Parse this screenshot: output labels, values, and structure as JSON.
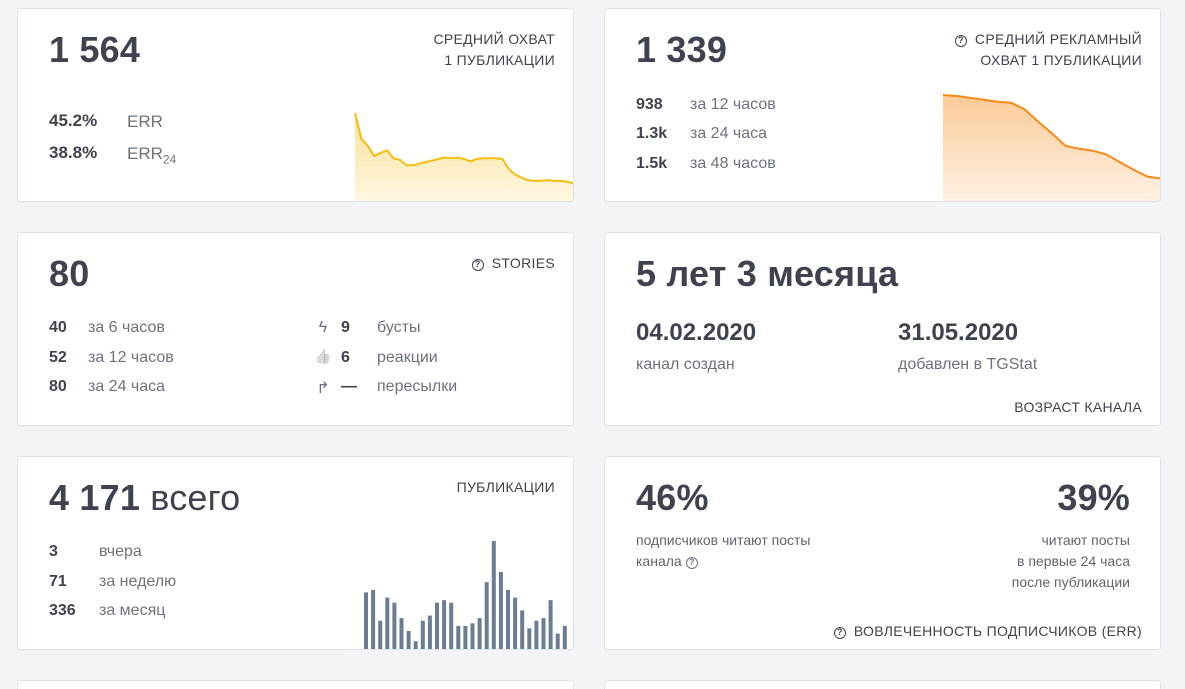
{
  "reach": {
    "value": "1 564",
    "caption_line1": "СРЕДНИЙ ОХВАТ",
    "caption_line2": "1 ПУБЛИКАЦИИ",
    "err_value": "45.2%",
    "err_label": "ERR",
    "err24_value": "38.8%",
    "err24_label": "ERR",
    "err24_sub": "24",
    "chart_color": "#f5bd0f"
  },
  "ad_reach": {
    "value": "1 339",
    "caption_line1": "СРЕДНИЙ РЕКЛАМНЫЙ",
    "caption_line2": "ОХВАТ 1 ПУБЛИКАЦИИ",
    "help_icon": "?",
    "rows": [
      {
        "value": "938",
        "label": "за 12 часов"
      },
      {
        "value": "1.3k",
        "label": "за 24 часа"
      },
      {
        "value": "1.5k",
        "label": "за 48 часов"
      }
    ],
    "chart_color": "#f78a16"
  },
  "stories": {
    "value": "80",
    "caption": "STORIES",
    "help_icon": "?",
    "rows": [
      {
        "value": "40",
        "label": "за 6 часов"
      },
      {
        "value": "52",
        "label": "за 12 часов"
      },
      {
        "value": "80",
        "label": "за 24 часа"
      }
    ],
    "stats": [
      {
        "icon": "lightning-icon",
        "glyph": "ϟ",
        "value": "9",
        "label": "бусты"
      },
      {
        "icon": "thumbs-up-icon",
        "glyph": "👍",
        "value": "6",
        "label": "реакции"
      },
      {
        "icon": "share-arrow-icon",
        "glyph": "↱",
        "value": "—",
        "label": "пересылки"
      }
    ]
  },
  "age": {
    "value": "5 лет 3 месяца",
    "created_date": "04.02.2020",
    "created_label": "канал создан",
    "added_date": "31.05.2020",
    "added_label": "добавлен в TGStat",
    "caption": "ВОЗРАСТ КАНАЛА"
  },
  "posts": {
    "value": "4 171",
    "suffix": "всего",
    "caption": "ПУБЛИКАЦИИ",
    "rows": [
      {
        "value": "3",
        "label": "вчера"
      },
      {
        "value": "71",
        "label": "за неделю"
      },
      {
        "value": "336",
        "label": "за месяц"
      }
    ],
    "bar_color": "#6a7d94"
  },
  "engagement": {
    "left_value": "46%",
    "left_text_line1": "подписчиков читают посты",
    "left_text_line2": "канала",
    "right_value": "39%",
    "right_text_line1": "читают посты",
    "right_text_line2": "в первые 24 часа",
    "right_text_line3": "после публикации",
    "caption": "ВОВЛЕЧЕННОСТЬ ПОДПИСЧИКОВ (ERR)",
    "help_icon": "?"
  },
  "chart_data": [
    {
      "type": "area",
      "series": [
        {
          "values": [
            100,
            67,
            58,
            45,
            49,
            52,
            42,
            40,
            33,
            33,
            35,
            37,
            39,
            41,
            43,
            42,
            43,
            41,
            38,
            41,
            42,
            42,
            42,
            41,
            28,
            21,
            17,
            14,
            13,
            13,
            14,
            13,
            13,
            12,
            10
          ]
        }
      ]
    },
    {
      "type": "area",
      "series": [
        {
          "values": [
            100,
            99,
            97,
            95,
            93,
            92,
            85,
            72,
            60,
            47,
            44,
            42,
            38,
            30,
            22,
            15,
            13
          ]
        }
      ]
    },
    {
      "type": "bar",
      "values": [
        22,
        23,
        11,
        20,
        18,
        12,
        7,
        3,
        11,
        13,
        18,
        19,
        18,
        9,
        9,
        10,
        12,
        26,
        42,
        30,
        23,
        20,
        15,
        8,
        11,
        12,
        19,
        6,
        9
      ]
    }
  ]
}
